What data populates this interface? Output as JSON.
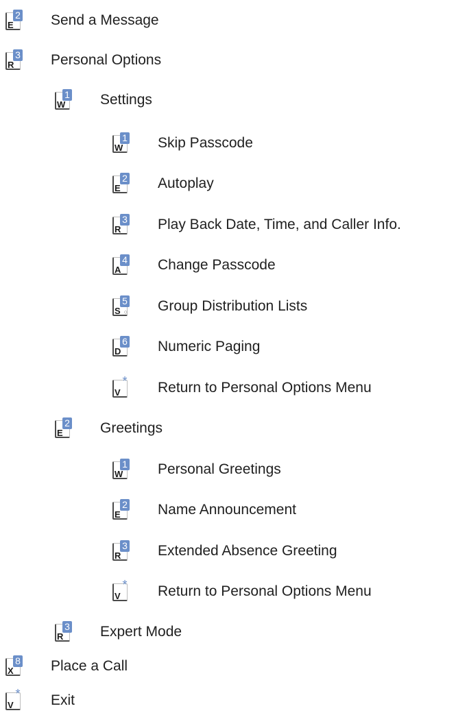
{
  "items": [
    {
      "letter": "E",
      "number": "2",
      "label": "Send a Message"
    },
    {
      "letter": "R",
      "number": "3",
      "label": "Personal Options"
    },
    {
      "letter": "W",
      "number": "1",
      "label": "Settings"
    },
    {
      "letter": "W",
      "number": "1",
      "label": "Skip Passcode"
    },
    {
      "letter": "E",
      "number": "2",
      "label": "Autoplay"
    },
    {
      "letter": "R",
      "number": "3",
      "label": "Play Back Date, Time, and Caller Info."
    },
    {
      "letter": "A",
      "number": "4",
      "label": "Change Passcode"
    },
    {
      "letter": "S",
      "number": "5",
      "sub": "○",
      "label": "Group Distribution Lists"
    },
    {
      "letter": "D",
      "number": "6",
      "label": "Numeric Paging"
    },
    {
      "letter": "V",
      "number": "*",
      "label": "Return to Personal Options Menu"
    },
    {
      "letter": "E",
      "number": "2",
      "label": "Greetings"
    },
    {
      "letter": "W",
      "number": "1",
      "label": "Personal Greetings"
    },
    {
      "letter": "E",
      "number": "2",
      "label": "Name Announcement"
    },
    {
      "letter": "R",
      "number": "3",
      "label": "Extended Absence Greeting"
    },
    {
      "letter": "V",
      "number": "*",
      "label": "Return to Personal Options Menu"
    },
    {
      "letter": "R",
      "number": "3",
      "label": "Expert Mode"
    },
    {
      "letter": "X",
      "number": "8",
      "label": "Place a Call"
    },
    {
      "letter": "V",
      "number": "*",
      "label": "Exit"
    }
  ],
  "colors": {
    "key_accent": "#6b8fc9",
    "text": "#1f1f1f"
  }
}
